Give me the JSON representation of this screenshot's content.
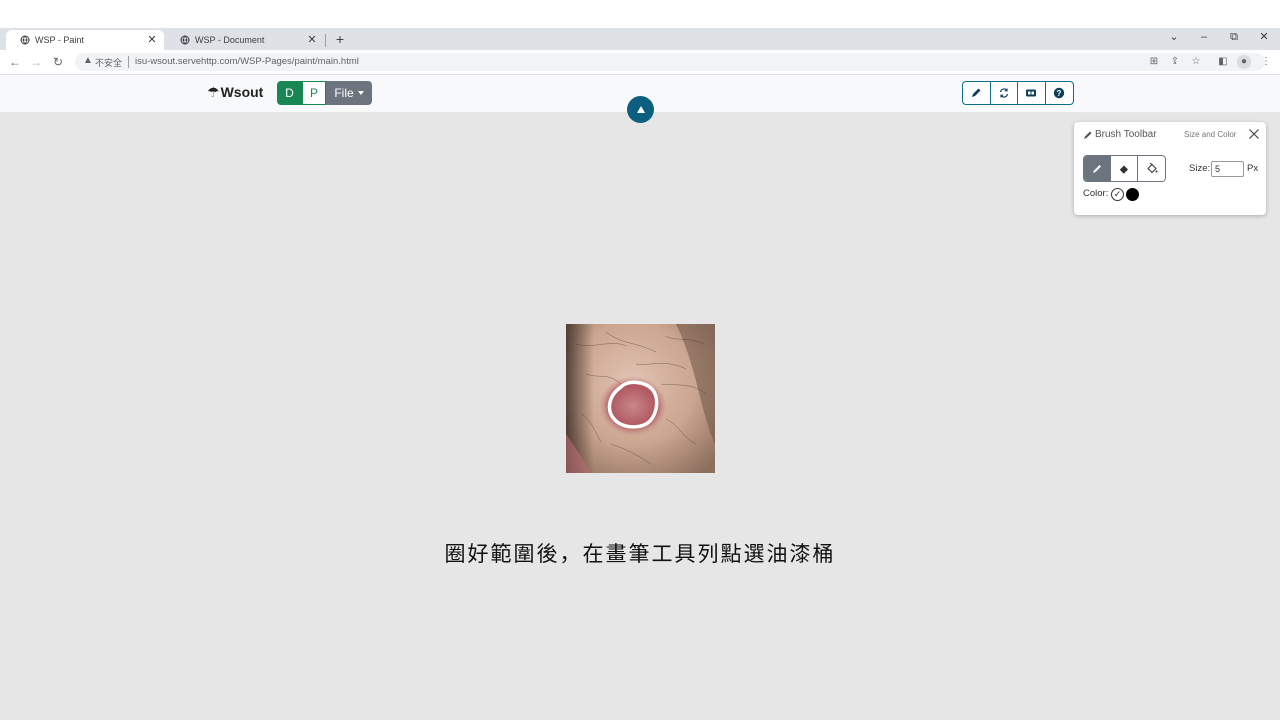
{
  "browser": {
    "tabs": [
      {
        "title": "WSP - Paint",
        "active": true,
        "icon": "globe-icon"
      },
      {
        "title": "WSP - Document",
        "active": false,
        "icon": "globe-icon"
      }
    ],
    "new_tab": "+",
    "window_controls": {
      "tab_search": "⌄",
      "minimize": "–",
      "restore": "⧉",
      "close": "✕"
    },
    "security_label": "不安全",
    "url": "isu-wsout.servehttp.com/WSP-Pages/paint/main.html"
  },
  "app": {
    "brand": "Wsout",
    "brand_icon": "umbrella-icon",
    "mode_buttons": {
      "d": "D",
      "p": "P"
    },
    "file_menu": "File",
    "tools": [
      "pencil-icon",
      "refresh-icon",
      "ocr-icon",
      "help-icon"
    ]
  },
  "brush_toolbar": {
    "title": "Brush Toolbar",
    "subtitle": "Size and Color",
    "modes": [
      "brush-icon",
      "eraser-icon",
      "fill-bucket-icon"
    ],
    "active_mode": 0,
    "size_label": "Size:",
    "size_value": "5",
    "unit": "Px",
    "color_label": "Color:",
    "color": "#000000"
  },
  "caption": "圈好範圍後，在畫筆工具列點選油漆桶",
  "colors": {
    "canvas_bg": "#e6e6e6",
    "green": "#198754",
    "gray": "#6c757d",
    "teal": "#0d5f80"
  }
}
